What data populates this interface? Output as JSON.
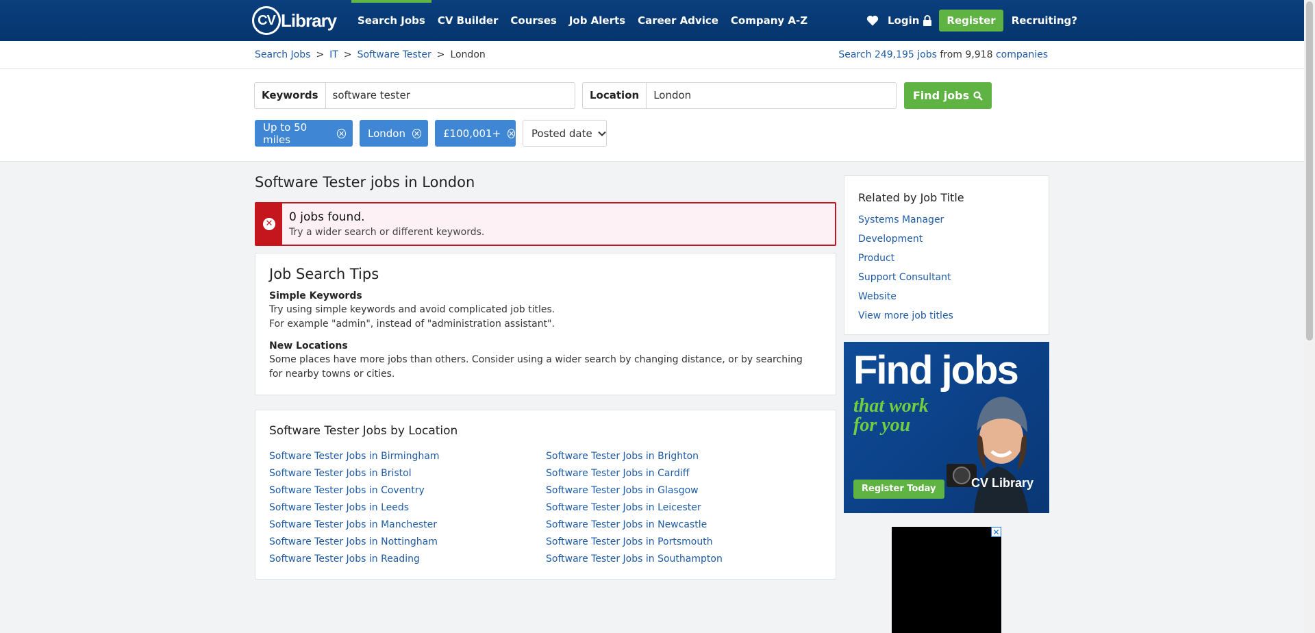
{
  "nav": {
    "logo_badge": "CV",
    "logo_word": "Library",
    "links": [
      "Search Jobs",
      "CV Builder",
      "Courses",
      "Job Alerts",
      "Career Advice",
      "Company A-Z"
    ],
    "login": "Login",
    "register": "Register",
    "recruiting": "Recruiting?"
  },
  "breadcrumb": {
    "items": [
      "Search Jobs",
      "IT",
      "Software Tester",
      "London"
    ],
    "separator": ">"
  },
  "stats": {
    "prefix": "Search",
    "jobs_count": "249,195",
    "jobs_word": "jobs",
    "from": "from",
    "companies_count": "9,918",
    "companies_word": "companies"
  },
  "search": {
    "keywords_label": "Keywords",
    "keywords_value": "software tester",
    "location_label": "Location",
    "location_value": "London",
    "find_button": "Find jobs"
  },
  "filters": {
    "chips": [
      "Up to 50 miles",
      "London",
      "£100,001+"
    ],
    "posted_date": "Posted date"
  },
  "main": {
    "title": "Software Tester jobs in London",
    "alert": {
      "heading": "0 jobs found.",
      "body": "Try a wider search or different keywords."
    },
    "tips": {
      "title": "Job Search Tips",
      "h1": "Simple Keywords",
      "p1a": "Try using simple keywords and avoid complicated job titles.",
      "p1b": "For example \"admin\", instead of \"administration assistant\".",
      "h2": "New Locations",
      "p2": "Some places have more jobs than others. Consider using a wider search by changing distance, or by searching for nearby towns or cities."
    },
    "by_location": {
      "title": "Software Tester Jobs by Location",
      "left": [
        "Software Tester Jobs in Birmingham",
        "Software Tester Jobs in Bristol",
        "Software Tester Jobs in Coventry",
        "Software Tester Jobs in Leeds",
        "Software Tester Jobs in Manchester",
        "Software Tester Jobs in Nottingham",
        "Software Tester Jobs in Reading"
      ],
      "right": [
        "Software Tester Jobs in Brighton",
        "Software Tester Jobs in Cardiff",
        "Software Tester Jobs in Glasgow",
        "Software Tester Jobs in Leicester",
        "Software Tester Jobs in Newcastle",
        "Software Tester Jobs in Portsmouth",
        "Software Tester Jobs in Southampton"
      ]
    }
  },
  "sidebar": {
    "related_title": "Related by Job Title",
    "related": [
      "Systems Manager",
      "Development",
      "Product",
      "Support Consultant",
      "Website",
      "View more job titles"
    ],
    "ad": {
      "headline": "Find jobs",
      "tagline": "that work for you",
      "cta": "Register Today",
      "brand": "CV Library"
    },
    "video_close": "✕"
  },
  "colors": {
    "nav_bg": "#06356c",
    "accent_green": "#5fb342",
    "link_blue": "#1f5ba5",
    "chip_blue": "#3f86d4",
    "alert_red": "#c4161c"
  }
}
